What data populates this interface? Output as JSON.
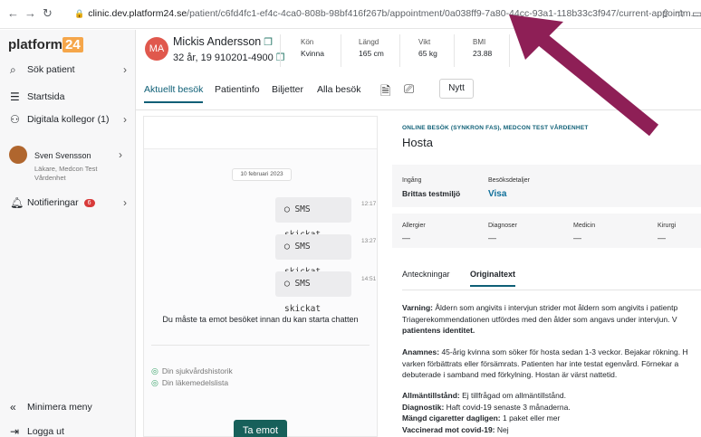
{
  "browser": {
    "url_host": "clinic.dev.platform24.se",
    "url_path": "/patient/c6fd4fc1-ef4c-4ca0-808b-98bf416f267b/appointment/0a038ff9-7a80-44cc-93a1-118b33c3f947/current-appointm..."
  },
  "sidebar": {
    "logo_text": "platform",
    "logo_num": "24",
    "search_label": "Sök patient",
    "home_label": "Startsida",
    "colleagues_label": "Digitala kollegor (1)",
    "user_name": "Sven Svensson",
    "user_role": "Läkare, Medcon Test Vårdenhet",
    "notifications_label": "Notifieringar",
    "notifications_count": "6",
    "minimize_label": "Minimera meny",
    "logout_label": "Logga ut"
  },
  "patient": {
    "initials": "MA",
    "name": "Mickis Andersson",
    "sub": "32 år, 19 910201-4900",
    "sex_label": "Kön",
    "sex_value": "Kvinna",
    "height_label": "Längd",
    "height_value": "165 cm",
    "weight_label": "Vikt",
    "weight_value": "65 kg",
    "bmi_label": "BMI",
    "bmi_value": "23.88"
  },
  "tabs": {
    "current_visit": "Aktuellt besök",
    "patient_info": "Patientinfo",
    "tickets": "Biljetter",
    "all_visits": "Alla besök",
    "new_button": "Nytt"
  },
  "chat": {
    "date": "10 februari 2023",
    "messages": [
      {
        "text": "SMS skickat",
        "time": "12:17"
      },
      {
        "text": "SMS skickat",
        "time": "13:27"
      },
      {
        "text": "SMS skickat",
        "time": "14:51"
      }
    ],
    "must_accept": "Du måste ta emot besöket innan du kan starta chatten",
    "check_history": "Din sjukvårdshistorik",
    "check_meds": "Din läkemedelslista",
    "accept_button": "Ta emot"
  },
  "visit": {
    "kicker": "ONLINE BESÖK (SYNKRON FAS), MEDCON TEST VÅRDENHET",
    "title": "Hosta",
    "entry_label": "Ingång",
    "entry_value": "Brittas testmiljö",
    "details_label": "Besöksdetaljer",
    "details_link": "Visa",
    "allergies_label": "Allergier",
    "diagnoses_label": "Diagnoser",
    "medicine_label": "Medicin",
    "surgery_label": "Kirurgi",
    "empty_value": "—",
    "tab_notes": "Anteckningar",
    "tab_original": "Originaltext",
    "warning_label": "Varning:",
    "warning_line1": " Åldern som angivits i intervjun strider mot åldern som angivits i patientp",
    "warning_line2": "Triagerekommendationen utfördes med den ålder som angavs under intervjun. V",
    "warning_line3": "patientens identitet.",
    "anamnes_label": "Anamnes:",
    "anamnes_line1": " 45-årig kvinna som söker för hosta sedan 1-3 veckor. Bejakar rökning. H",
    "anamnes_line2": "varken förbättrats eller försämrats. Patienten har inte testat egenvård. Förnekar a",
    "anamnes_line3": "debuterade i samband med förkylning. Hostan är värst nattetid.",
    "general_label": "Allmäntillstånd:",
    "general_value": " Ej tillfrågad om allmäntillstånd.",
    "diagnosis_label": "Diagnostik:",
    "diagnosis_value": " Haft covid-19 senaste 3 månaderna.",
    "cig_label": "Mängd cigaretter dagligen:",
    "cig_value": " 1 paket eller mer",
    "vacc_label": "Vaccinerad mot covid-19:",
    "vacc_value": " Nej"
  },
  "colors": {
    "accent": "#0e5f76",
    "accept_button": "#17605a",
    "arrow": "#8e1f56",
    "badge": "#d83a3a",
    "avatar_patient": "#e0584d"
  }
}
